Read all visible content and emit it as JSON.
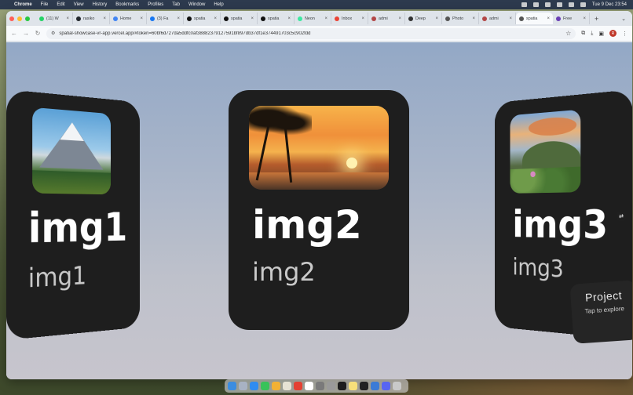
{
  "menubar": {
    "app": "Chrome",
    "items": [
      "File",
      "Edit",
      "View",
      "History",
      "Bookmarks",
      "Profiles",
      "Tab",
      "Window",
      "Help"
    ],
    "clock": "Tue 9 Dec  23:54"
  },
  "tabs": [
    {
      "label": "(11) W",
      "color": "#25d366"
    },
    {
      "label": "rasiko",
      "color": "#24292e"
    },
    {
      "label": "Home",
      "color": "#4285f4"
    },
    {
      "label": "(3) Fa",
      "color": "#1877f2"
    },
    {
      "label": "spatia",
      "color": "#111111"
    },
    {
      "label": "spatia",
      "color": "#111111"
    },
    {
      "label": "spatia",
      "color": "#111111"
    },
    {
      "label": "Neon",
      "color": "#3ee8a1"
    },
    {
      "label": "Inbox",
      "color": "#ea4335"
    },
    {
      "label": "admi",
      "color": "#b34747"
    },
    {
      "label": "Deep",
      "color": "#333333"
    },
    {
      "label": "Photo",
      "color": "#555555"
    },
    {
      "label": "admi",
      "color": "#b34747"
    },
    {
      "label": "spatia",
      "color": "#555555",
      "active": true
    },
    {
      "label": "Free",
      "color": "#6a3fb5"
    }
  ],
  "address_bar": {
    "url": "spatial-showcase-vr-app.vercel.app/#token=60bf6d727da5ddfc0af38882379127591bf897db37df1e374491703c5c902fdd",
    "avatar_letter": "R"
  },
  "cards": [
    {
      "title": "img1",
      "subtitle": "img1",
      "photo": "mountain"
    },
    {
      "title": "img2",
      "subtitle": "img2",
      "photo": "sunset-beach"
    },
    {
      "title": "img3",
      "subtitle": "img3",
      "photo": "hill-landscape"
    }
  ],
  "project_panel": {
    "title": "Project",
    "subtitle": "Tap to explore"
  },
  "accent_colors": {
    "card_bg": "#1e1e1e",
    "page_bg_top": "#93a8c6",
    "page_bg_bottom": "#c7c5cd"
  }
}
